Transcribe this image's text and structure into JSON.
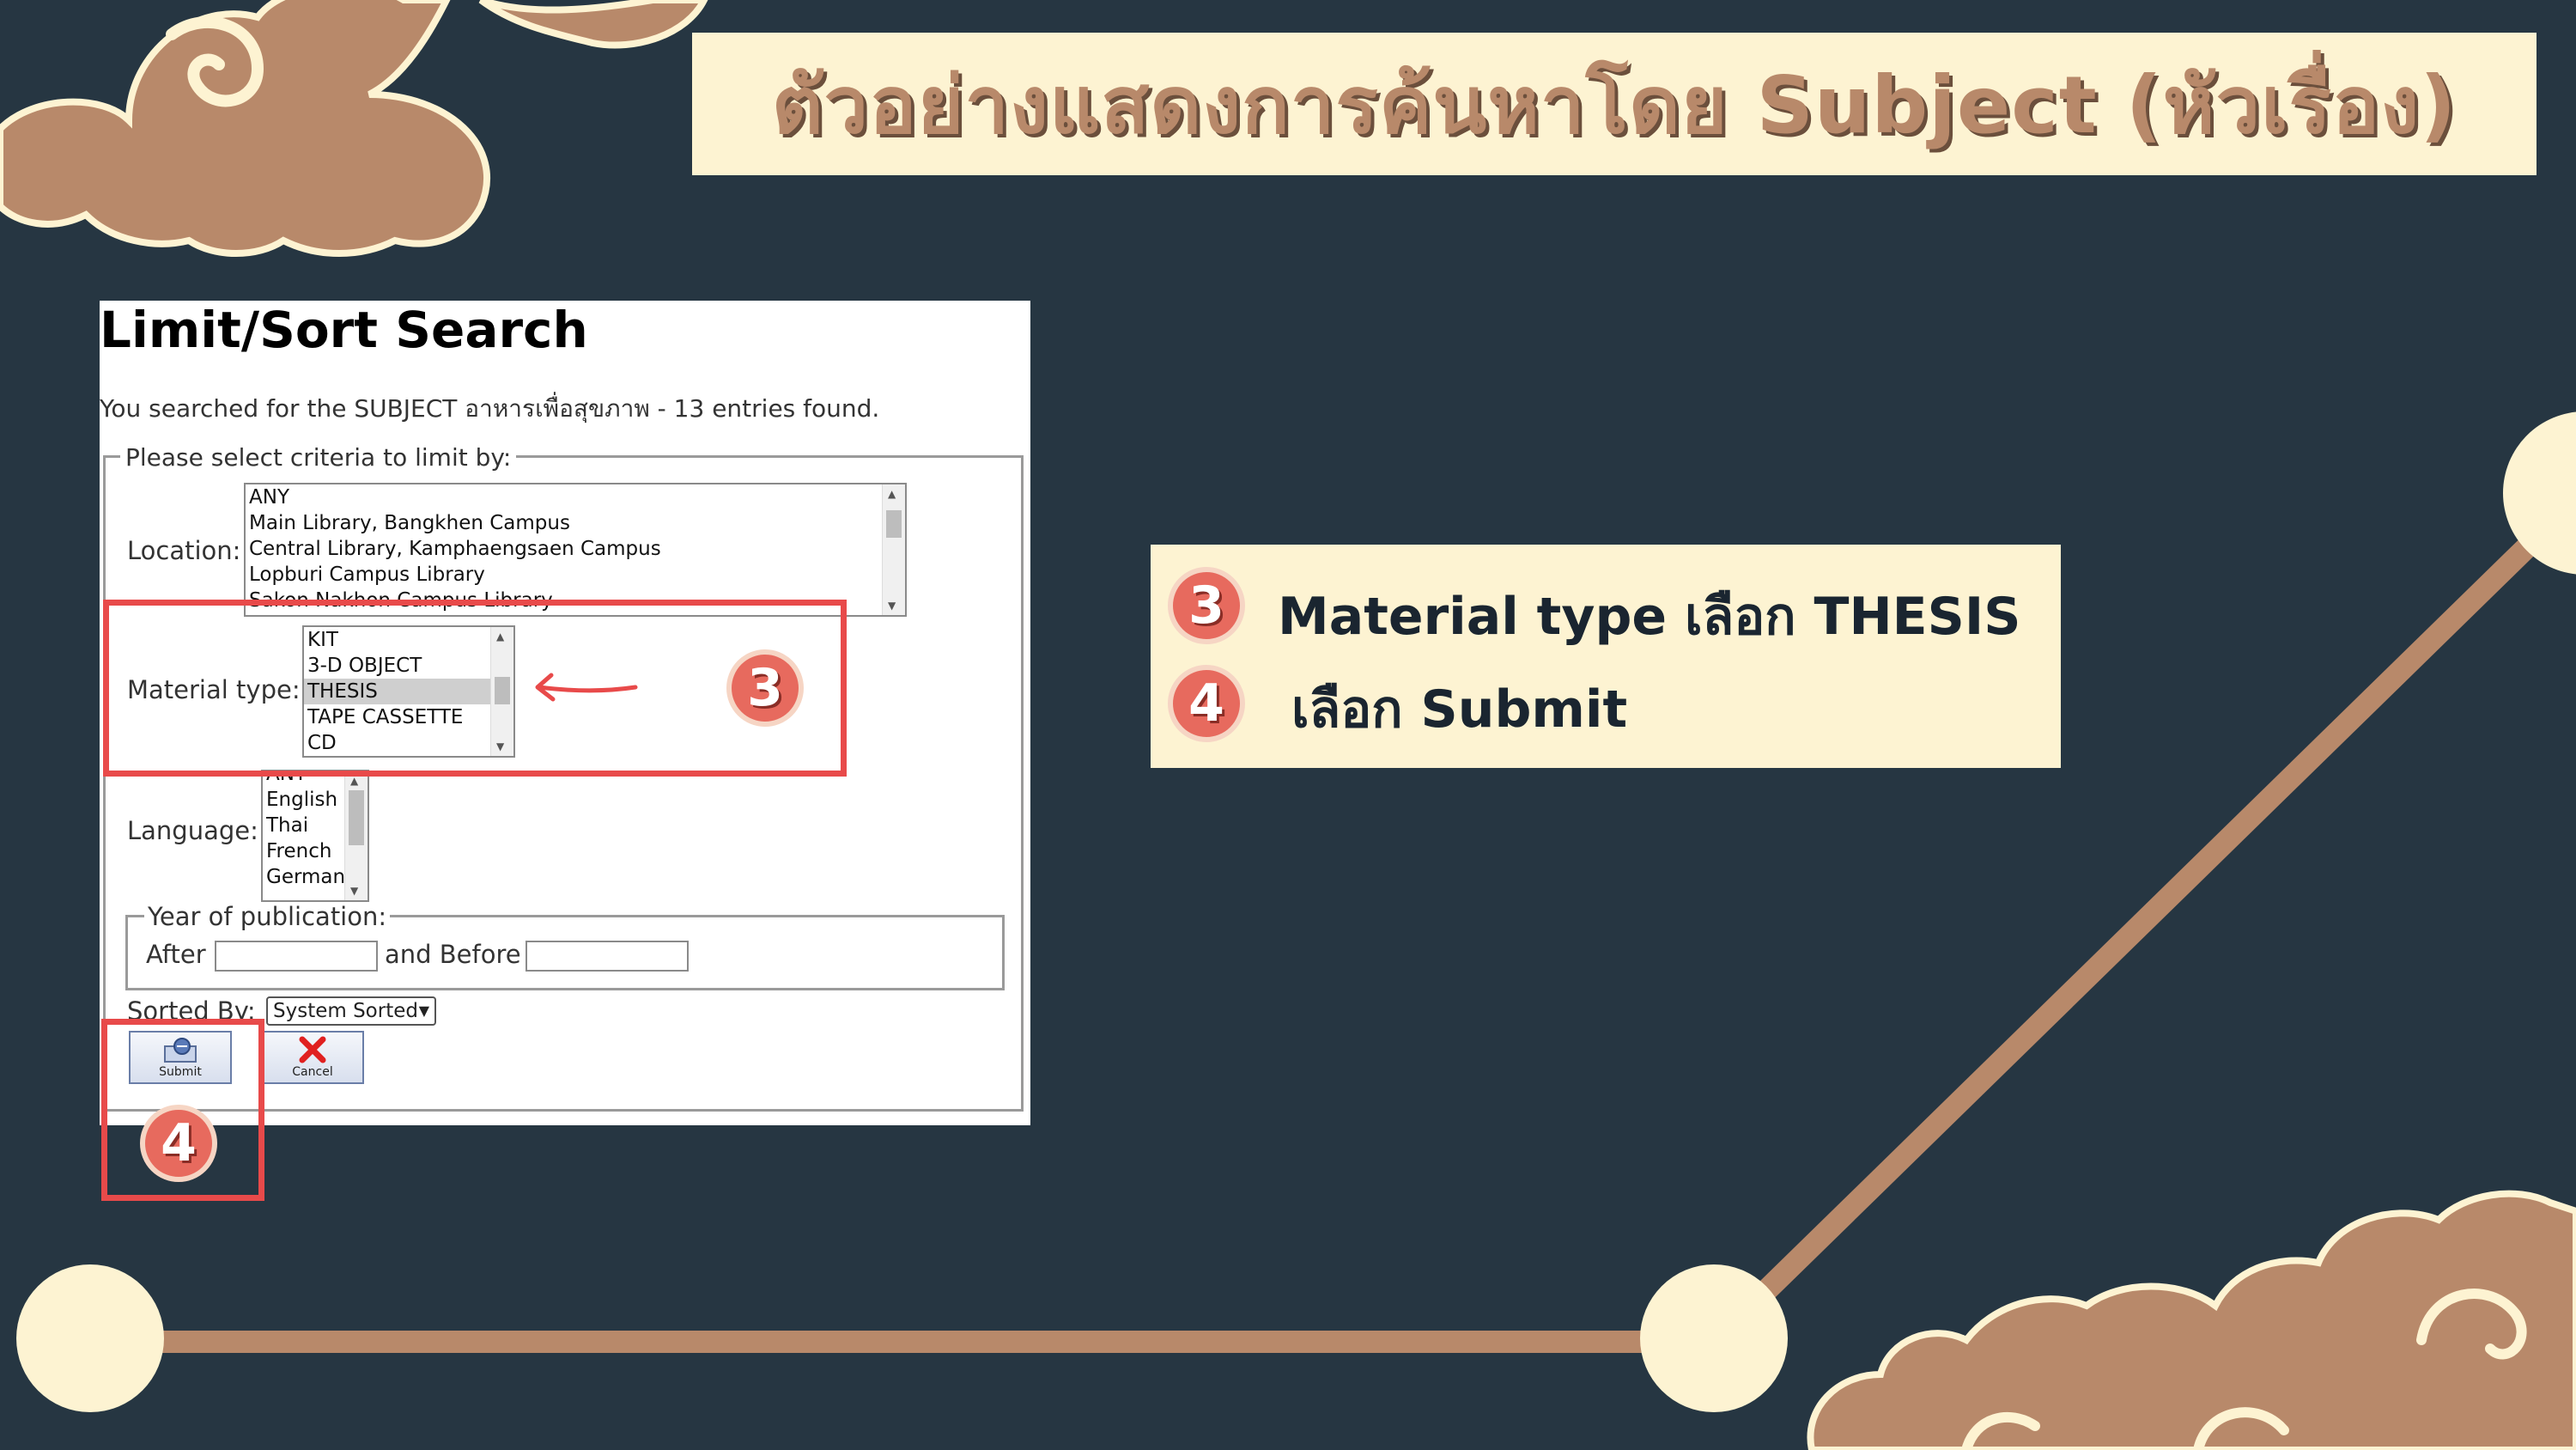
{
  "slide_title": "ตัวอย่างแสดงการค้นหาโดย Subject (หัวเรื่อง)",
  "screenshot": {
    "heading": "Limit/Sort Search",
    "summary": "You searched for the SUBJECT อาหารเพื่อสุขภาพ - 13 entries found.",
    "criteria_legend": "Please select criteria to limit by:",
    "location": {
      "label": "Location:",
      "options": [
        "ANY",
        "Main Library, Bangkhen Campus",
        "Central Library, Kamphaengsaen Campus",
        "Lopburi Campus Library",
        "Sakon Nakhon Campus Library"
      ]
    },
    "material_type": {
      "label": "Material type:",
      "options": [
        "KIT",
        "3-D OBJECT",
        "THESIS",
        "TAPE CASSETTE",
        "CD"
      ],
      "selected": "THESIS"
    },
    "language": {
      "label": "Language:",
      "options": [
        "ANY",
        "English",
        "Thai",
        "French",
        "German"
      ]
    },
    "year": {
      "legend": "Year of publication:",
      "after_label": "After",
      "after_value": "",
      "before_label": "and Before",
      "before_value": ""
    },
    "sorted_by": {
      "label": "Sorted By:",
      "value": "System Sorted"
    },
    "submit_label": "Submit",
    "cancel_label": "Cancel"
  },
  "badges": {
    "step3": "3",
    "step4": "4"
  },
  "instructions": {
    "line1": "Material type เลือก THESIS",
    "line2": "เลือก Submit"
  },
  "colors": {
    "background": "#263642",
    "cream": "#fdf3d2",
    "tan": "#b8896a",
    "highlight_red": "#e84a4a",
    "badge": "#e76a5e"
  }
}
